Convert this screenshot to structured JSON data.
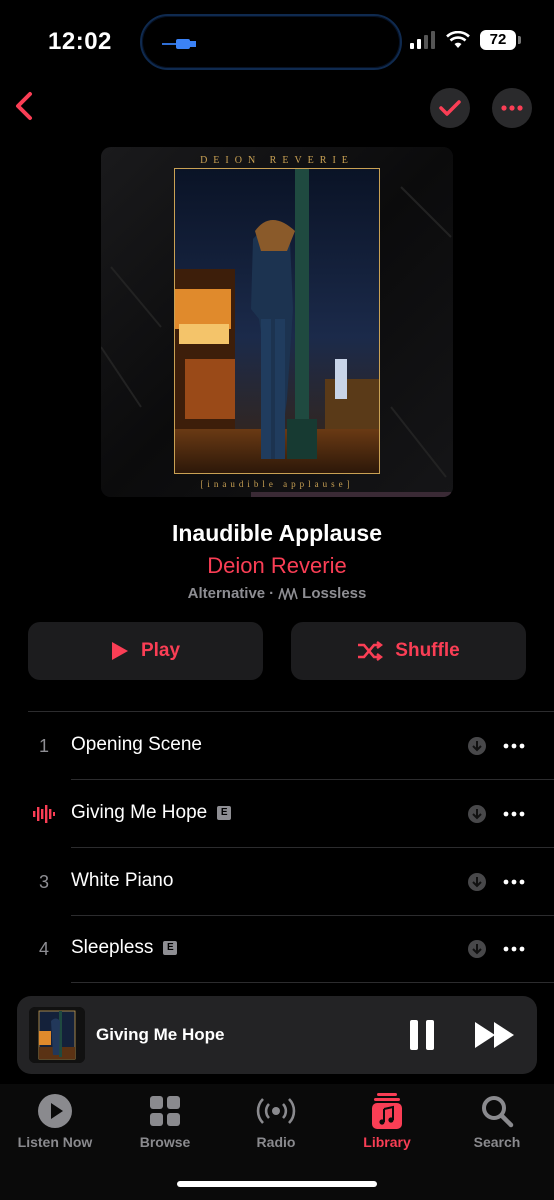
{
  "status_bar": {
    "time": "12:02",
    "battery": "72"
  },
  "album": {
    "art_header": "DEION REVERIE",
    "art_footer": "[inaudible applause]",
    "title": "Inaudible Applause",
    "artist": "Deion Reverie",
    "genre": "Alternative",
    "quality": "Lossless"
  },
  "actions": {
    "play_label": "Play",
    "shuffle_label": "Shuffle"
  },
  "tracks": [
    {
      "number": "1",
      "title": "Opening Scene",
      "explicit": false,
      "playing": false
    },
    {
      "number": "2",
      "title": "Giving Me Hope",
      "explicit": true,
      "playing": true
    },
    {
      "number": "3",
      "title": "White Piano",
      "explicit": false,
      "playing": false
    },
    {
      "number": "4",
      "title": "Sleepless",
      "explicit": true,
      "playing": false
    }
  ],
  "explicit_badge": "E",
  "mini_player": {
    "title": "Giving Me Hope"
  },
  "tabs": [
    {
      "label": "Listen Now",
      "icon": "play-circle-icon"
    },
    {
      "label": "Browse",
      "icon": "grid-icon"
    },
    {
      "label": "Radio",
      "icon": "radio-waves-icon"
    },
    {
      "label": "Library",
      "icon": "music-library-icon",
      "active": true
    },
    {
      "label": "Search",
      "icon": "magnifier-icon"
    }
  ],
  "colors": {
    "accent": "#fa3e55",
    "secondary_text": "#8e8e93",
    "surface": "#1c1c1e"
  }
}
